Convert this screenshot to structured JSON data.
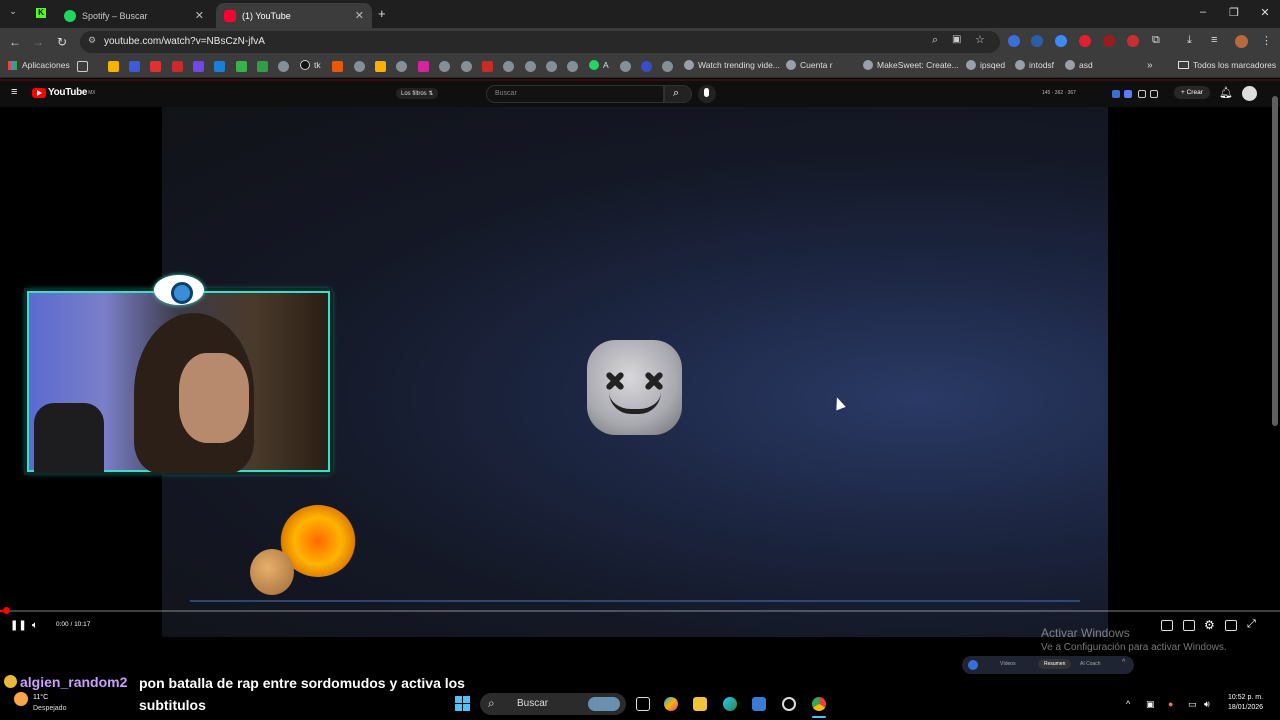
{
  "browser": {
    "tabs": [
      {
        "label": "Spotify – Buscar",
        "active": false,
        "color": "#1ed760"
      },
      {
        "label": "(1) YouTube",
        "active": true,
        "color": "#ff0033"
      }
    ],
    "url": "youtube.com/watch?v=NBsCzN-jfvA",
    "bookmarks": {
      "apps_label": "Aplicaciones",
      "items": [
        "tk",
        "A",
        "Watch trending vide...",
        "Cuenta r",
        "MakeSweet: Create...",
        "ipsqed",
        "intodsf",
        "asd"
      ],
      "all_label": "Todos los marcadores"
    }
  },
  "youtube": {
    "logo_text": "YouTube",
    "logo_sup": "MX",
    "filters_label": "Los filtros",
    "search_placeholder": "Buscar",
    "stats": "145 · 362 · 367",
    "create_label": "+ Crear"
  },
  "player": {
    "time": "0:00 / 10:17",
    "progress_fraction": 0.006,
    "accent": "#ff0000"
  },
  "overlay": {
    "windows_activation_title": "Activar Windows",
    "windows_activation_sub": "Ve a Configuración para activar Windows.",
    "summary_tabs": [
      "Vídeos",
      "Resumen",
      "AI Coach"
    ],
    "chat_user": "algien_random2",
    "chat_message_line1": "pon batalla de rap entre sordomudos y activa los",
    "chat_message_line2": "subtitulos"
  },
  "taskbar": {
    "weather_temp": "11°C",
    "weather_desc": "Despejado",
    "search_label": "Buscar",
    "time": "10:52 p. m.",
    "date": "18/01/2026"
  }
}
